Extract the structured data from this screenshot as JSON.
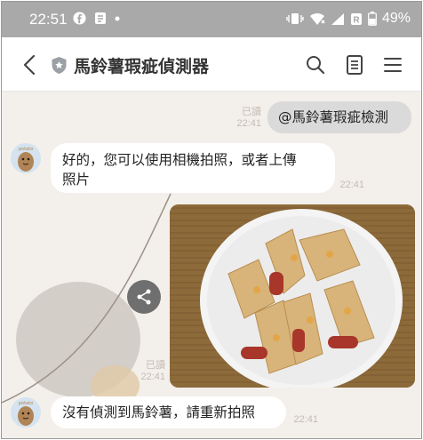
{
  "status_bar": {
    "time": "22:51",
    "battery": "49%",
    "icons": [
      "facebook-icon",
      "notification-icon",
      "dot-icon",
      "vibrate-icon",
      "wifi-icon",
      "signal-icon",
      "battery-icon"
    ]
  },
  "header": {
    "title": "馬鈴薯瑕疵偵測器",
    "icons": [
      "back-icon",
      "shield-icon",
      "search-icon",
      "notes-icon",
      "menu-icon"
    ]
  },
  "messages": {
    "m1": {
      "text": "@馬鈴薯瑕疵檢測",
      "read": "已讀",
      "time": "22:41"
    },
    "m2": {
      "line1": "好的，您可以使用相機拍照，或者上傳",
      "line2": "照片",
      "time": "22:41"
    },
    "m3": {
      "read": "已讀",
      "time": "22:41"
    },
    "m4": {
      "text": "沒有偵測到馬鈴薯，請重新拍照",
      "time": "22:41"
    }
  },
  "colors": {
    "status_bar": "#a9a9a9",
    "chat_bg": "#f3efea",
    "outgoing_bubble": "#dadada",
    "incoming_bubble": "#ffffff"
  }
}
